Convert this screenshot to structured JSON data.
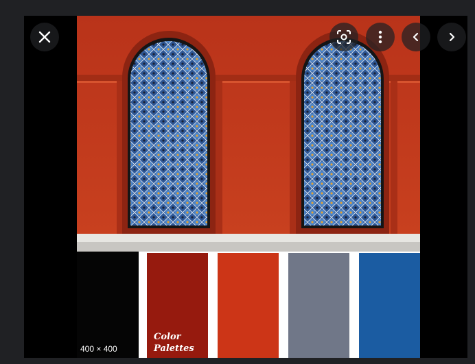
{
  "viewer": {
    "dimensions_label": "400 × 400",
    "buttons": {
      "close": "close-icon",
      "visual_search": "lens-icon",
      "more": "more-vert-icon",
      "previous": "chevron-left-icon",
      "next": "chevron-right-icon"
    }
  },
  "image": {
    "watermark_line1": "Color",
    "watermark_line2": "Palettes",
    "palette": [
      "#050505",
      "#961a0e",
      "#cc3517",
      "#707788",
      "#1b5ca2"
    ],
    "wall_color": "#c23a1e",
    "tile_color": "#3b68a8"
  }
}
